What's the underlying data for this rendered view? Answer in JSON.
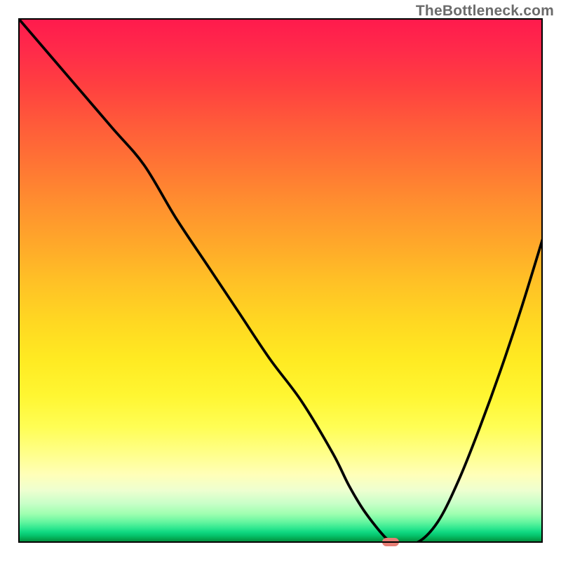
{
  "attribution": "TheBottleneck.com",
  "colors": {
    "marker": "#e77e75",
    "curve": "#000000",
    "frame": "#000000"
  },
  "chart_data": {
    "type": "line",
    "title": "",
    "xlabel": "",
    "ylabel": "",
    "xlim": [
      0,
      100
    ],
    "ylim": [
      0,
      100
    ],
    "grid": false,
    "series": [
      {
        "name": "bottleneck-curve",
        "x": [
          0,
          6,
          12,
          18,
          24,
          30,
          36,
          42,
          48,
          54,
          60,
          63,
          66,
          70,
          72,
          76,
          80,
          84,
          88,
          92,
          96,
          100
        ],
        "values": [
          100,
          93,
          86,
          79,
          72,
          62,
          53,
          44,
          35,
          27,
          17,
          11,
          6,
          1,
          0,
          0,
          4,
          12,
          22,
          33,
          45,
          58
        ]
      }
    ],
    "annotations": [
      {
        "name": "optimal-marker",
        "x": 71,
        "y": 0.2
      }
    ]
  }
}
